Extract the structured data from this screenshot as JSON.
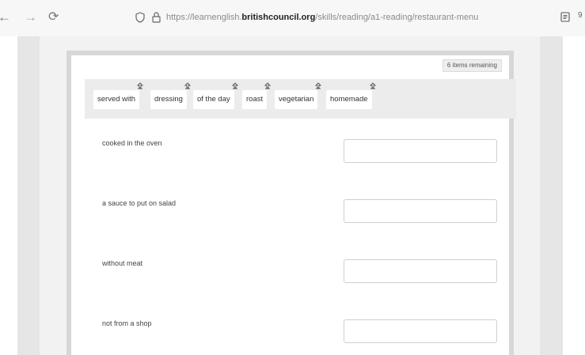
{
  "browser": {
    "back": "←",
    "forward": "→",
    "reload": "⟳",
    "url_prefix": "https://learnenglish.",
    "url_domain": "britishcouncil.org",
    "url_path": "/skills/reading/a1-reading/restaurant-menu",
    "edge_text": "9"
  },
  "exercise": {
    "remaining": "6 items remaining",
    "word_bank": [
      {
        "label": "served with"
      },
      {
        "label": "dressing"
      },
      {
        "label": "of the day"
      },
      {
        "label": "roast"
      },
      {
        "label": "vegetarian"
      },
      {
        "label": "homemade"
      }
    ],
    "questions": [
      {
        "prompt": "cooked in the oven",
        "answer": ""
      },
      {
        "prompt": "a sauce to put on salad",
        "answer": ""
      },
      {
        "prompt": "without meat",
        "answer": ""
      },
      {
        "prompt": "not from a shop",
        "answer": ""
      }
    ]
  },
  "icons": {
    "drag": "drag-handle-icon",
    "shield": "shield-icon",
    "lock": "lock-icon",
    "reader": "reader-view-icon"
  }
}
